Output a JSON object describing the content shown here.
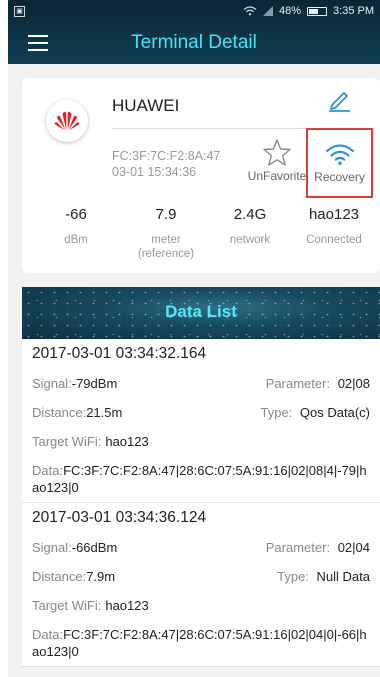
{
  "status_bar": {
    "battery": "48%",
    "time": "3:35 PM"
  },
  "header": {
    "title": "Terminal Detail"
  },
  "terminal": {
    "brand": "HUAWEI",
    "mac": "FC:3F:7C:F2:8A:47",
    "time": "03-01 15:34:36",
    "favorite_label": "UnFavorite",
    "recovery_label": "Recovery",
    "stats": [
      {
        "value": "-66",
        "label": "dBm"
      },
      {
        "value": "7.9",
        "label": "meter (reference)"
      },
      {
        "value": "2.4G",
        "label": "network"
      },
      {
        "value": "hao123",
        "label": "Connected"
      }
    ]
  },
  "data_list": {
    "title": "Data List",
    "signal_label": "Signal:",
    "parameter_label": "Parameter:",
    "distance_label": "Distance:",
    "type_label": "Type:",
    "target_label": "Target WiFi:",
    "data_label": "Data:",
    "records": [
      {
        "time": "2017-03-01 03:34:32.164",
        "signal": "-79dBm",
        "parameter": "02|08",
        "distance": "21.5m",
        "type": "Qos Data(c)",
        "target": "hao123",
        "data": "FC:3F:7C:F2:8A:47|28:6C:07:5A:91:16|02|08|4|-79|hao123|0"
      },
      {
        "time": "2017-03-01 03:34:36.124",
        "signal": "-66dBm",
        "parameter": "02|04",
        "distance": "7.9m",
        "type": "Null Data",
        "target": "hao123",
        "data": "FC:3F:7C:F2:8A:47|28:6C:07:5A:91:16|02|04|0|-66|hao123|0"
      }
    ]
  },
  "colors": {
    "accent": "#4fe0f0",
    "header_bg": "#0d3446",
    "highlight": "#d9403a",
    "link_blue": "#2f95d6"
  }
}
